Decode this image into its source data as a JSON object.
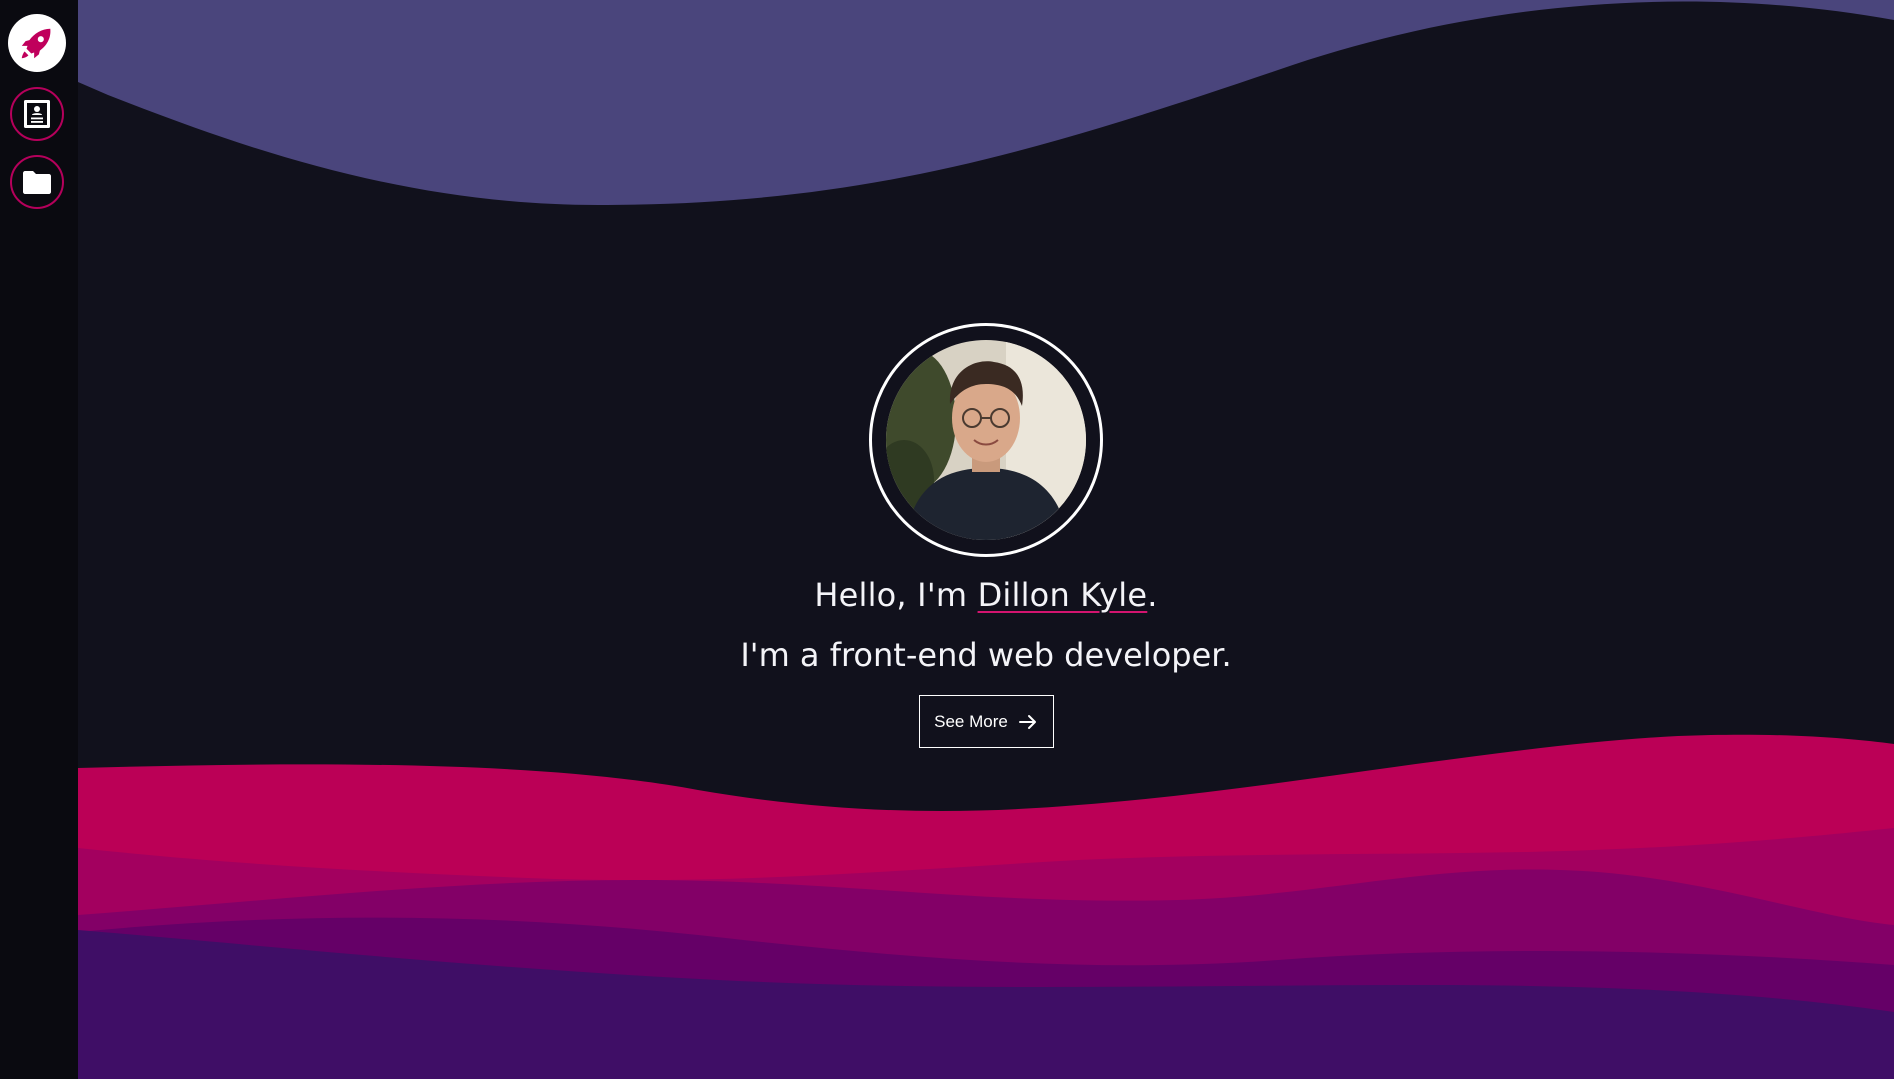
{
  "sidebar": {
    "items": [
      {
        "id": "home",
        "icon": "rocket-icon"
      },
      {
        "id": "about",
        "icon": "contact-card-icon"
      },
      {
        "id": "projects",
        "icon": "folder-icon"
      }
    ]
  },
  "hero": {
    "avatar_alt": "portrait-photo",
    "greeting_prefix": "Hello, I'm ",
    "name": "Dillon Kyle",
    "greeting_suffix": ".",
    "tagline": "I'm a front-end web developer.",
    "cta_label": "See More",
    "cta_icon": "arrow-right-icon"
  },
  "colors": {
    "background": "#11111c",
    "sidebar": "#0a0a10",
    "top_wave": "#4a457c",
    "accent_pink": "#bb0056",
    "wave_magenta": "#a3005f",
    "wave_plum": "#830067",
    "wave_grape": "#650067",
    "wave_purple": "#3f0e66",
    "text": "#f4f4f8"
  }
}
